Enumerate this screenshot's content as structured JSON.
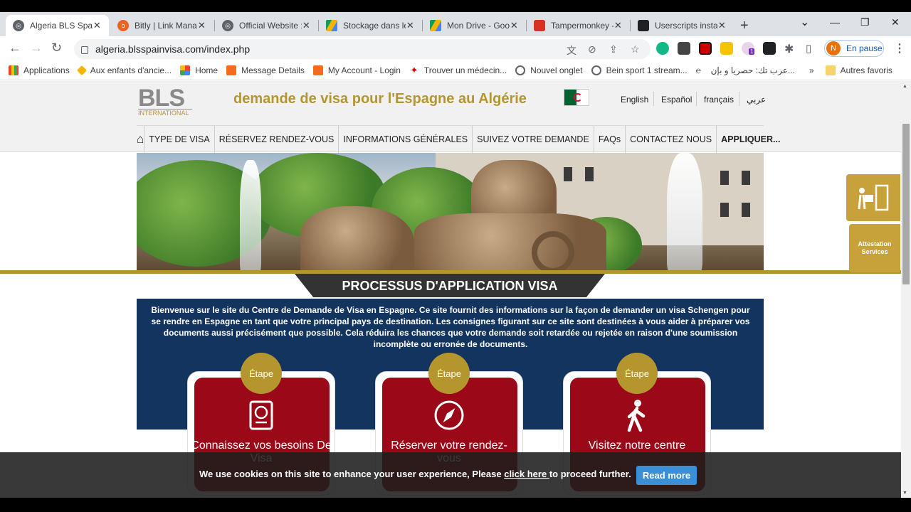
{
  "browser": {
    "tabs": [
      {
        "title": "Algeria BLS Spain",
        "active": true
      },
      {
        "title": "Bitly | Link Manag",
        "active": false
      },
      {
        "title": "Official Website :",
        "active": false
      },
      {
        "title": "Stockage dans le",
        "active": false
      },
      {
        "title": "Mon Drive - Goo",
        "active": false
      },
      {
        "title": "Tampermonkey -",
        "active": false
      },
      {
        "title": "Userscripts instal",
        "active": false
      }
    ],
    "url": "algeria.blsspainvisa.com/index.php",
    "profile_initial": "N",
    "profile_label": "En pause",
    "ext_badge": "1",
    "bookmarks": [
      "Applications",
      "Aux enfants d'ancie...",
      "Home",
      "Message Details",
      "My Account - Login",
      "Trouver un médecin...",
      "Nouvel onglet",
      "Bein sport 1 stream...",
      "عرب تك: حصريا و بإن...",
      "Autres favoris"
    ]
  },
  "site": {
    "logo_main": "BLS",
    "logo_sub": "INTERNATIONAL",
    "headline": "demande de visa pour l'Espagne au Algérie",
    "languages": [
      "English",
      "Español",
      "français",
      "عربي"
    ],
    "nav": [
      "TYPE DE VISA",
      "RÉSERVEZ RENDEZ-VOUS",
      "INFORMATIONS GÉNÉRALES",
      "SUIVEZ VOTRE DEMANDE",
      "FAQs",
      "CONTACTEZ NOUS",
      "APPLIQUER..."
    ],
    "process_title": "PROCESSUS D'APPLICATION VISA",
    "intro": "Bienvenue sur le site du Centre de Demande de Visa en Espagne. Ce site fournit des informations sur la façon de demander un visa Schengen pour se rendre en Espagne en tant que votre principal pays de destination. Les consignes figurant sur ce site sont destinées à vous aider à préparer vos documents aussi précisément que possible. Cela réduira les chances que votre demande soit retardée ou rejetée en raison d'une soumission incomplète ou erronée de documents.",
    "steps": [
      {
        "badge": "Étape",
        "title": "Connaissez vos besoins De Visa",
        "icon": "passport-icon"
      },
      {
        "badge": "Étape",
        "title": "Réserver votre rendez-vous",
        "icon": "compass-icon"
      },
      {
        "badge": "Étape",
        "title": "Visitez notre centre",
        "icon": "walking-person-icon"
      }
    ],
    "side_attestation": "Attestation Services",
    "cookie_text_before": "We use cookies on this site to enhance your user experience, Please ",
    "cookie_link": "click here ",
    "cookie_text_after": "to proceed further.",
    "read_more": "Read more"
  },
  "colors": {
    "gold": "#b5952e",
    "navy": "#12345e",
    "crimson": "#9b0817"
  }
}
